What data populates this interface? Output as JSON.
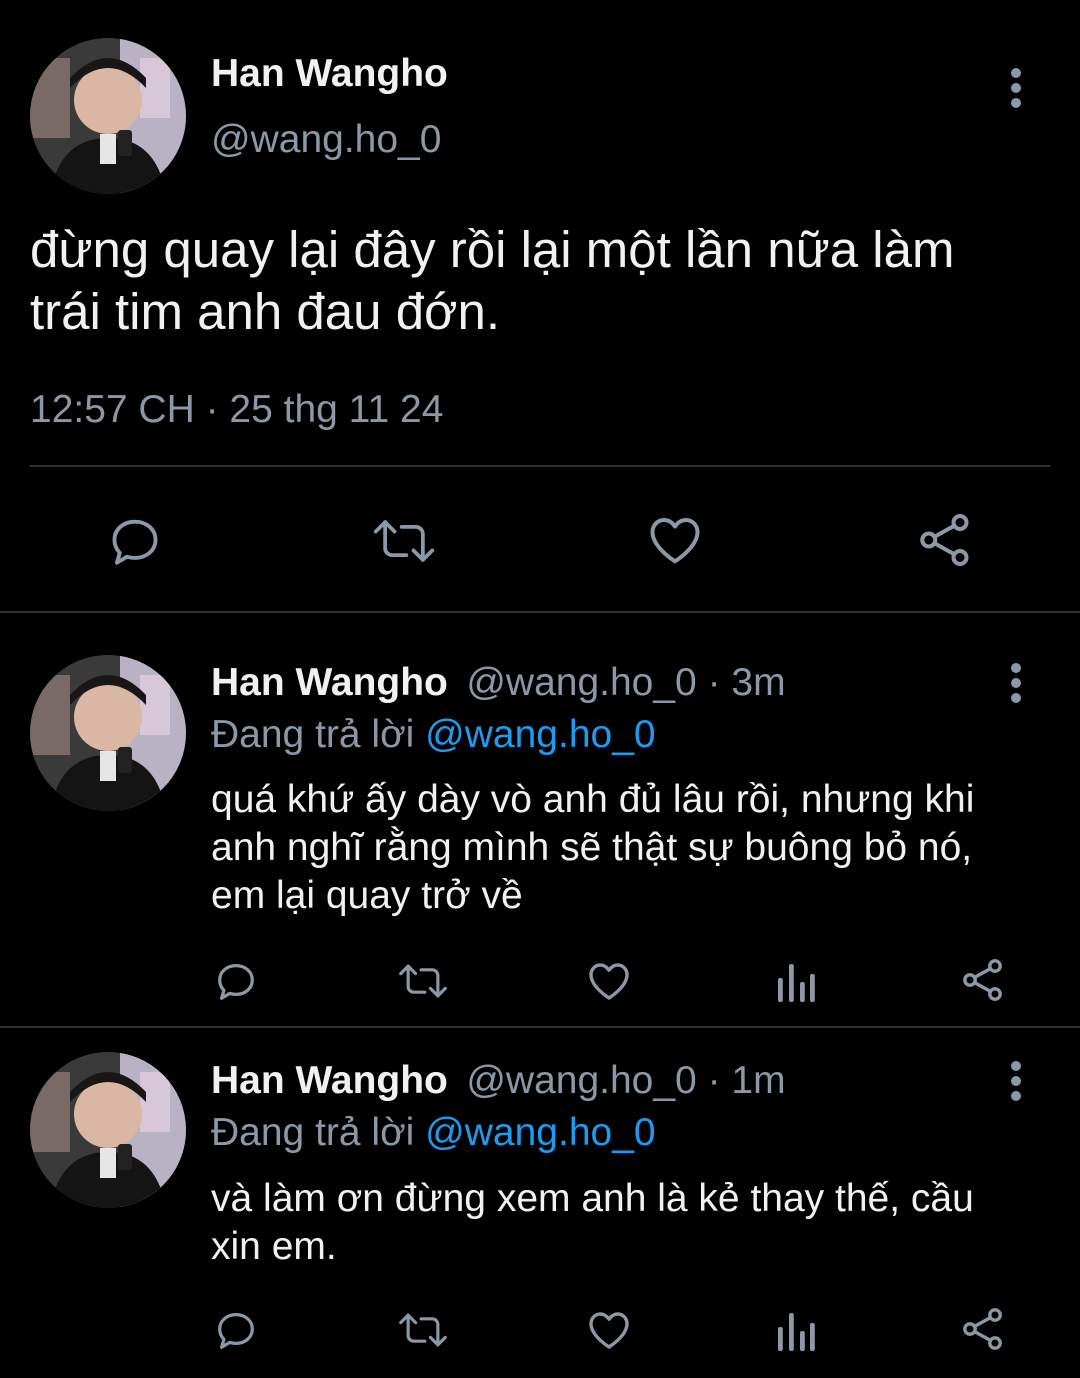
{
  "main_tweet": {
    "author_name": "Han Wangho",
    "author_handle": "@wang.ho_0",
    "text_line1": "đừng quay lại đây rồi lại một lần nữa làm",
    "text_line2": "trái tim anh đau đớn.",
    "timestamp": "12:57 CH · 25 thg 11 24",
    "actions": [
      "reply-icon",
      "retweet-icon",
      "like-icon",
      "share-icon"
    ]
  },
  "replies": [
    {
      "author_name": "Han Wangho",
      "author_handle_time": "@wang.ho_0 · 3m",
      "reply_prefix": "Đang trả lời",
      "reply_mention": "@wang.ho_0",
      "lines": [
        "quá khứ ấy dày vò anh đủ lâu rồi, nhưng khi",
        "anh nghĩ rằng mình sẽ thật sự buông bỏ nó,",
        "em lại quay trở về"
      ],
      "actions": [
        "reply-icon",
        "retweet-icon",
        "like-icon",
        "views-icon",
        "share-icon"
      ]
    },
    {
      "author_name": "Han Wangho",
      "author_handle_time": "@wang.ho_0 · 1m",
      "reply_prefix": "Đang trả lời",
      "reply_mention": "@wang.ho_0",
      "lines": [
        "và làm ơn đừng xem anh là kẻ thay thế, cầu",
        "xin em."
      ],
      "actions": [
        "reply-icon",
        "retweet-icon",
        "like-icon",
        "views-icon",
        "share-icon"
      ]
    }
  ],
  "colors": {
    "background": "#000000",
    "text": "#f1f1f1",
    "secondary": "#8b98a5",
    "mention": "#1d9bf0",
    "divider": "#2f3336"
  }
}
